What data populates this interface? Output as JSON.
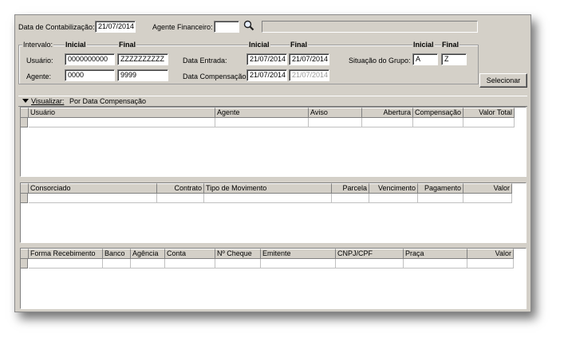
{
  "header": {
    "data_contab_label": "Data de Contabilização:",
    "data_contab_value": "21/07/2014",
    "agente_fin_label": "Agente Financeiro:",
    "agente_fin_value": "",
    "agente_fin_desc": ""
  },
  "intervalo": {
    "group_label": "Intervalo:",
    "inicial_label": "Inicial",
    "final_label": "Final",
    "usuario_label": "Usuário:",
    "usuario_inicial": "0000000000",
    "usuario_final": "ZZZZZZZZZZ",
    "agente_label": "Agente:",
    "agente_inicial": "0000",
    "agente_final": "9999",
    "inicial2_label": "Inicial",
    "final2_label": "Final",
    "data_entrada_label": "Data Entrada:",
    "data_entrada_inicial": "21/07/2014",
    "data_entrada_final": "21/07/2014",
    "data_comp_label": "Data Compensação:",
    "data_comp_inicial": "21/07/2014",
    "data_comp_final": "21/07/2014",
    "inicial3_label": "Inicial",
    "final3_label": "Final",
    "situacao_label": "Situação do Grupo:",
    "situacao_inicial": "A",
    "situacao_final": "Z"
  },
  "actions": {
    "selecionar_label": "Selecionar"
  },
  "view_bar": {
    "prefix": "Visualizar:",
    "value": "Por Data Compensação"
  },
  "grid1": {
    "columns": [
      "Usuário",
      "Agente",
      "Aviso",
      "Abertura",
      "Compensação",
      "Valor Total"
    ]
  },
  "grid2": {
    "columns": [
      "Consorciado",
      "Contrato",
      "Tipo de Movimento",
      "Parcela",
      "Vencimento",
      "Pagamento",
      "Valor"
    ]
  },
  "grid3": {
    "columns": [
      "Forma Recebimento",
      "Banco",
      "Agência",
      "Conta",
      "Nº Cheque",
      "Emitente",
      "CNPJ/CPF",
      "Praça",
      "Valor"
    ]
  },
  "icons": {
    "search": "magnifier-icon",
    "collapse": "triangle-down-icon"
  }
}
